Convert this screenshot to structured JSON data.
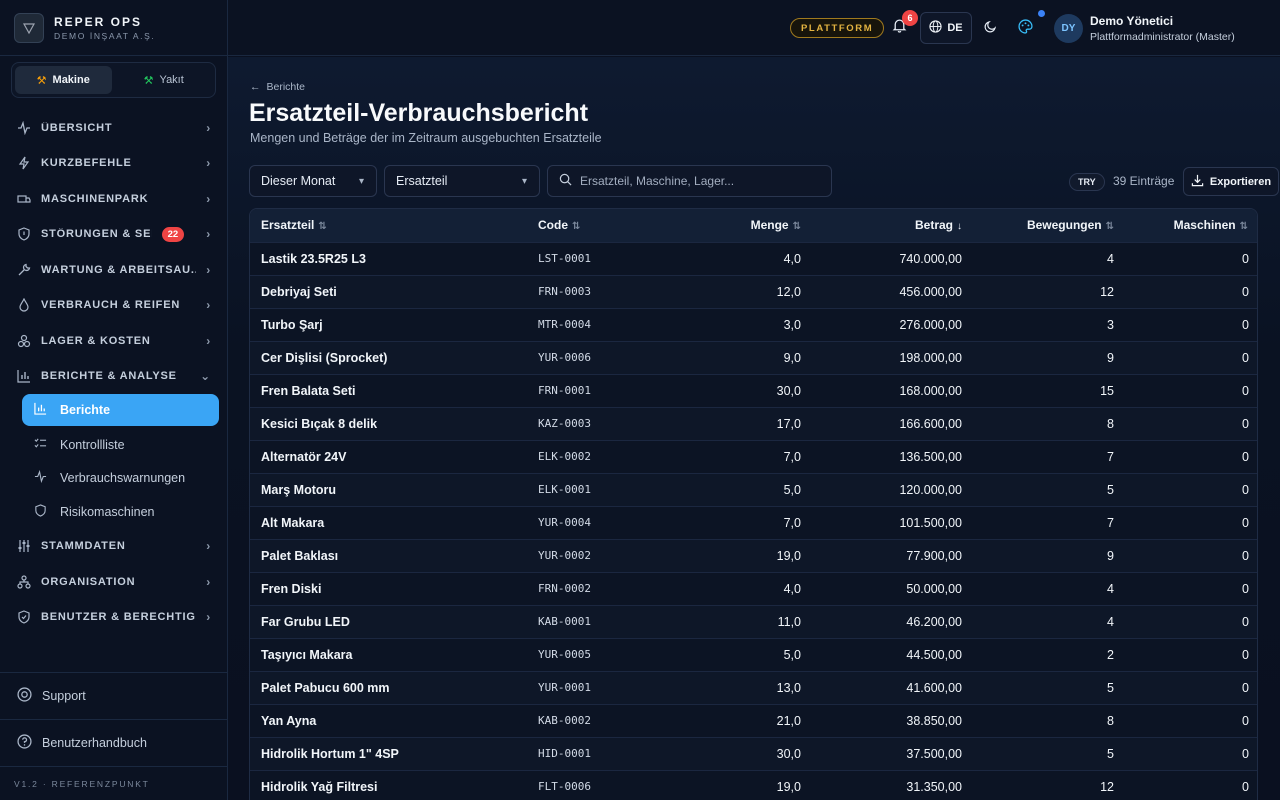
{
  "brand": {
    "name": "REPER OPS",
    "company": "DEMO İNŞAAT A.Ş.",
    "logo_icon": "reper-logo-icon"
  },
  "mode_switch": {
    "options": [
      {
        "label": "Makine",
        "active": true
      },
      {
        "label": "Yakıt",
        "active": false
      }
    ]
  },
  "nav": {
    "items": [
      {
        "label": "ÜBERSICHT",
        "icon": "activity-icon"
      },
      {
        "label": "KURZBEFEHLE",
        "icon": "bolt-icon"
      },
      {
        "label": "MASCHINENPARK",
        "icon": "truck-icon"
      },
      {
        "label": "STÖRUNGEN & SER...",
        "icon": "shield-alert-icon",
        "badge": "22"
      },
      {
        "label": "WARTUNG & ARBEITSAU...",
        "icon": "wrench-icon"
      },
      {
        "label": "VERBRAUCH & REIFEN",
        "icon": "drop-icon"
      },
      {
        "label": "LAGER & KOSTEN",
        "icon": "boxes-icon"
      },
      {
        "label": "BERICHTE & ANALYSE",
        "icon": "bar-chart-icon",
        "expanded": true
      },
      {
        "label": "STAMMDATEN",
        "icon": "sliders-icon"
      },
      {
        "label": "ORGANISATION",
        "icon": "org-icon"
      },
      {
        "label": "BENUTZER & BERECHTIG...",
        "icon": "shield-user-icon"
      }
    ],
    "sub_items": [
      {
        "label": "Berichte",
        "icon": "bar-chart-icon",
        "active": true
      },
      {
        "label": "Kontrollliste",
        "icon": "checklist-icon"
      },
      {
        "label": "Verbrauchswarnungen",
        "icon": "pulse-icon"
      },
      {
        "label": "Risikomaschinen",
        "icon": "shield-icon"
      }
    ]
  },
  "footer": {
    "support": "Support",
    "manual": "Benutzerhandbuch",
    "version": "V1.2 · REFERENZPUNKT"
  },
  "header": {
    "platform_pill": "PLATTFORM",
    "notifications_count": "6",
    "language": "DE",
    "avatar_initials": "DY",
    "user_name": "Demo Yönetici",
    "user_role": "Plattformadministrator (Master)"
  },
  "page": {
    "breadcrumb": "Berichte",
    "title": "Ersatzteil-Verbrauchsbericht",
    "subtitle": "Mengen und Beträge der im Zeitraum ausgebuchten Ersatzteile"
  },
  "filters": {
    "period": "Dieser Monat",
    "type": "Ersatzteil",
    "search_placeholder": "Ersatzteil, Maschine, Lager...",
    "currency": "TRY",
    "entries": "39 Einträge",
    "export_label": "Exportieren"
  },
  "table": {
    "columns": [
      "Ersatzteil",
      "Code",
      "Menge",
      "Betrag",
      "Bewegungen",
      "Maschinen"
    ],
    "rows": [
      [
        "Lastik 23.5R25 L3",
        "LST-0001",
        "4,0",
        "740.000,00",
        "4",
        "0"
      ],
      [
        "Debriyaj Seti",
        "FRN-0003",
        "12,0",
        "456.000,00",
        "12",
        "0"
      ],
      [
        "Turbo Şarj",
        "MTR-0004",
        "3,0",
        "276.000,00",
        "3",
        "0"
      ],
      [
        "Cer Dişlisi (Sprocket)",
        "YUR-0006",
        "9,0",
        "198.000,00",
        "9",
        "0"
      ],
      [
        "Fren Balata Seti",
        "FRN-0001",
        "30,0",
        "168.000,00",
        "15",
        "0"
      ],
      [
        "Kesici Bıçak 8 delik",
        "KAZ-0003",
        "17,0",
        "166.600,00",
        "8",
        "0"
      ],
      [
        "Alternatör 24V",
        "ELK-0002",
        "7,0",
        "136.500,00",
        "7",
        "0"
      ],
      [
        "Marş Motoru",
        "ELK-0001",
        "5,0",
        "120.000,00",
        "5",
        "0"
      ],
      [
        "Alt Makara",
        "YUR-0004",
        "7,0",
        "101.500,00",
        "7",
        "0"
      ],
      [
        "Palet Baklası",
        "YUR-0002",
        "19,0",
        "77.900,00",
        "9",
        "0"
      ],
      [
        "Fren Diski",
        "FRN-0002",
        "4,0",
        "50.000,00",
        "4",
        "0"
      ],
      [
        "Far Grubu LED",
        "KAB-0001",
        "11,0",
        "46.200,00",
        "4",
        "0"
      ],
      [
        "Taşıyıcı Makara",
        "YUR-0005",
        "5,0",
        "44.500,00",
        "2",
        "0"
      ],
      [
        "Palet Pabucu 600 mm",
        "YUR-0001",
        "13,0",
        "41.600,00",
        "5",
        "0"
      ],
      [
        "Yan Ayna",
        "KAB-0002",
        "21,0",
        "38.850,00",
        "8",
        "0"
      ],
      [
        "Hidrolik Hortum 1\" 4SP",
        "HID-0001",
        "30,0",
        "37.500,00",
        "5",
        "0"
      ],
      [
        "Hidrolik Yağ Filtresi",
        "FLT-0006",
        "19,0",
        "31.350,00",
        "12",
        "0"
      ]
    ]
  },
  "colors": {
    "accent": "#3aa5f5",
    "badge": "#ef4444",
    "platform": "#e3b341"
  }
}
